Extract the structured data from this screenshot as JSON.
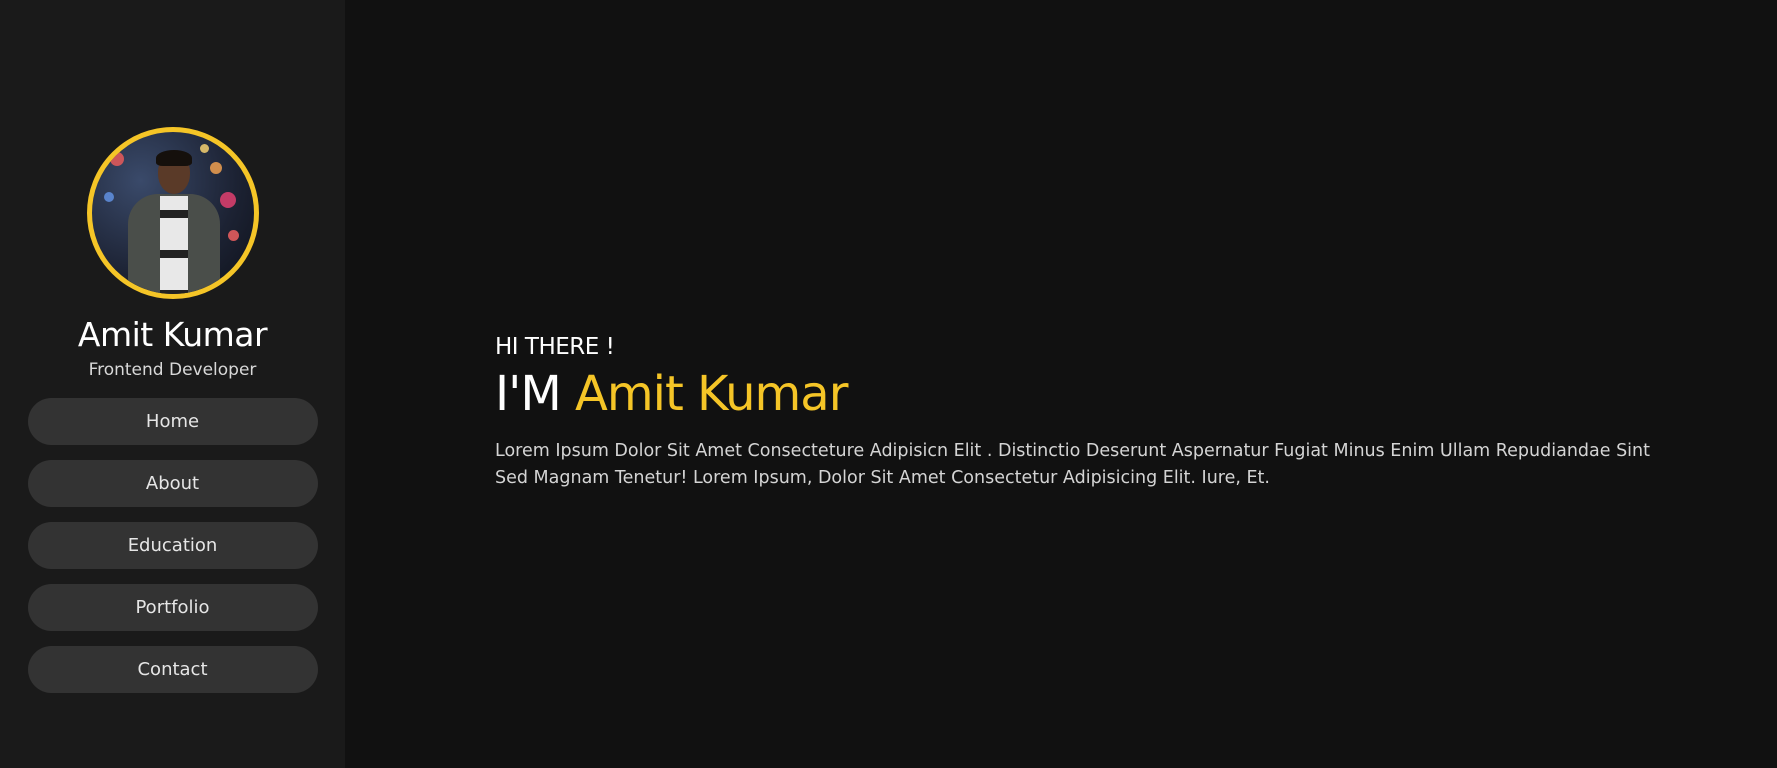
{
  "sidebar": {
    "profile": {
      "name": "Amit Kumar",
      "role": "Frontend Developer"
    },
    "nav": [
      {
        "label": "Home"
      },
      {
        "label": "About"
      },
      {
        "label": "Education"
      },
      {
        "label": "Portfolio"
      },
      {
        "label": "Contact"
      }
    ]
  },
  "hero": {
    "greeting": "HI THERE !",
    "headline_prefix": "I'M",
    "headline_name": "Amit Kumar",
    "intro": "Lorem Ipsum Dolor Sit Amet Consecteture Adipisicn Elit . Distinctio Deserunt Aspernatur Fugiat Minus Enim Ullam Repudiandae Sint Sed Magnam Tenetur! Lorem Ipsum, Dolor Sit Amet Consectetur Adipisicing Elit. Iure, Et."
  },
  "colors": {
    "accent": "#f5c527",
    "sidebar_bg": "#1a1a1a",
    "page_bg": "#111111",
    "nav_button_bg": "#333333"
  }
}
